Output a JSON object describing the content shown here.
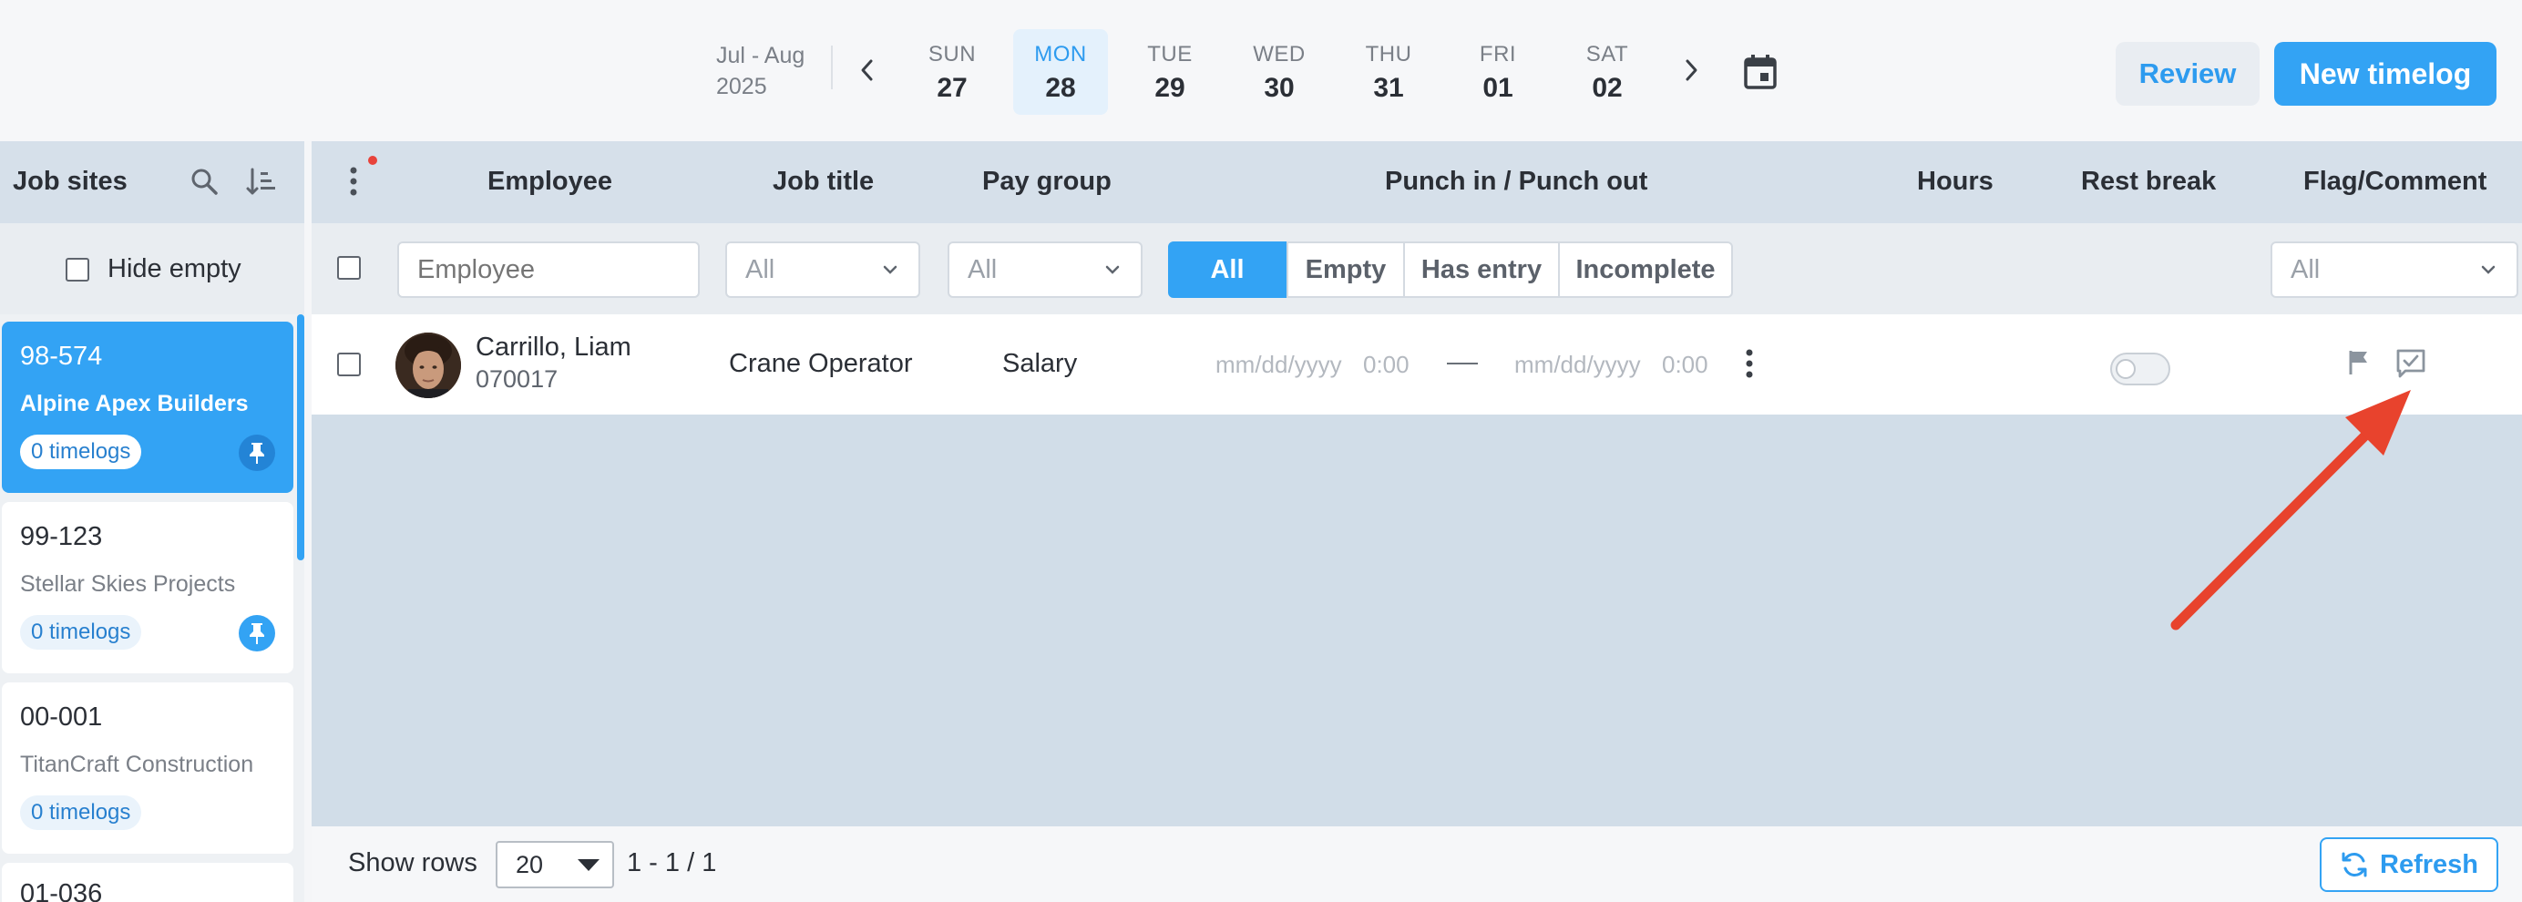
{
  "header": {
    "range_line1": "Jul - Aug",
    "range_line2": "2025",
    "days": [
      {
        "dow": "SUN",
        "num": "27"
      },
      {
        "dow": "MON",
        "num": "28"
      },
      {
        "dow": "TUE",
        "num": "29"
      },
      {
        "dow": "WED",
        "num": "30"
      },
      {
        "dow": "THU",
        "num": "31"
      },
      {
        "dow": "FRI",
        "num": "01"
      },
      {
        "dow": "SAT",
        "num": "02"
      }
    ],
    "selected_day": "MON",
    "review_label": "Review",
    "new_timelog_label": "New timelog"
  },
  "sidebar": {
    "title": "Job sites",
    "hide_empty_label": "Hide empty",
    "sites": [
      {
        "code": "98-574",
        "name": "Alpine Apex Builders",
        "count": "0 timelogs",
        "pinned": true,
        "active": true
      },
      {
        "code": "99-123",
        "name": "Stellar Skies Projects",
        "count": "0 timelogs",
        "pinned": true,
        "active": false
      },
      {
        "code": "00-001",
        "name": "TitanCraft Construction",
        "count": "0 timelogs",
        "pinned": false,
        "active": false
      },
      {
        "code": "01-036",
        "name": "",
        "count": "",
        "pinned": false,
        "active": false
      }
    ]
  },
  "columns": {
    "employee": "Employee",
    "job_title": "Job title",
    "pay_group": "Pay group",
    "punch": "Punch in / Punch out",
    "hours": "Hours",
    "rest_break": "Rest break",
    "flag_comment": "Flag/Comment"
  },
  "filters": {
    "employee_placeholder": "Employee",
    "job_title_value": "All",
    "pay_group_value": "All",
    "segments": [
      "All",
      "Empty",
      "Has entry",
      "Incomplete"
    ],
    "active_segment": "All",
    "flag_value": "All"
  },
  "rows": [
    {
      "name": "Carrillo, Liam",
      "employee_id": "070017",
      "job_title": "Crane Operator",
      "pay_group": "Salary",
      "punch_in_date": "mm/dd/yyyy",
      "punch_in_time": "0:00",
      "punch_out_date": "mm/dd/yyyy",
      "punch_out_time": "0:00",
      "rest_break": false
    }
  ],
  "footer": {
    "show_rows_label": "Show rows",
    "rows_per_page": "20",
    "pagination": "1 - 1 / 1",
    "refresh_label": "Refresh"
  },
  "colors": {
    "accent": "#33a3f4",
    "annotation_arrow": "#e8432d"
  },
  "icons": [
    "chevron-left-icon",
    "chevron-right-icon",
    "calendar-icon",
    "search-icon",
    "sort-icon",
    "kebab-icon",
    "pin-icon",
    "chevron-down-icon",
    "flag-icon",
    "comment-check-icon",
    "refresh-icon"
  ]
}
